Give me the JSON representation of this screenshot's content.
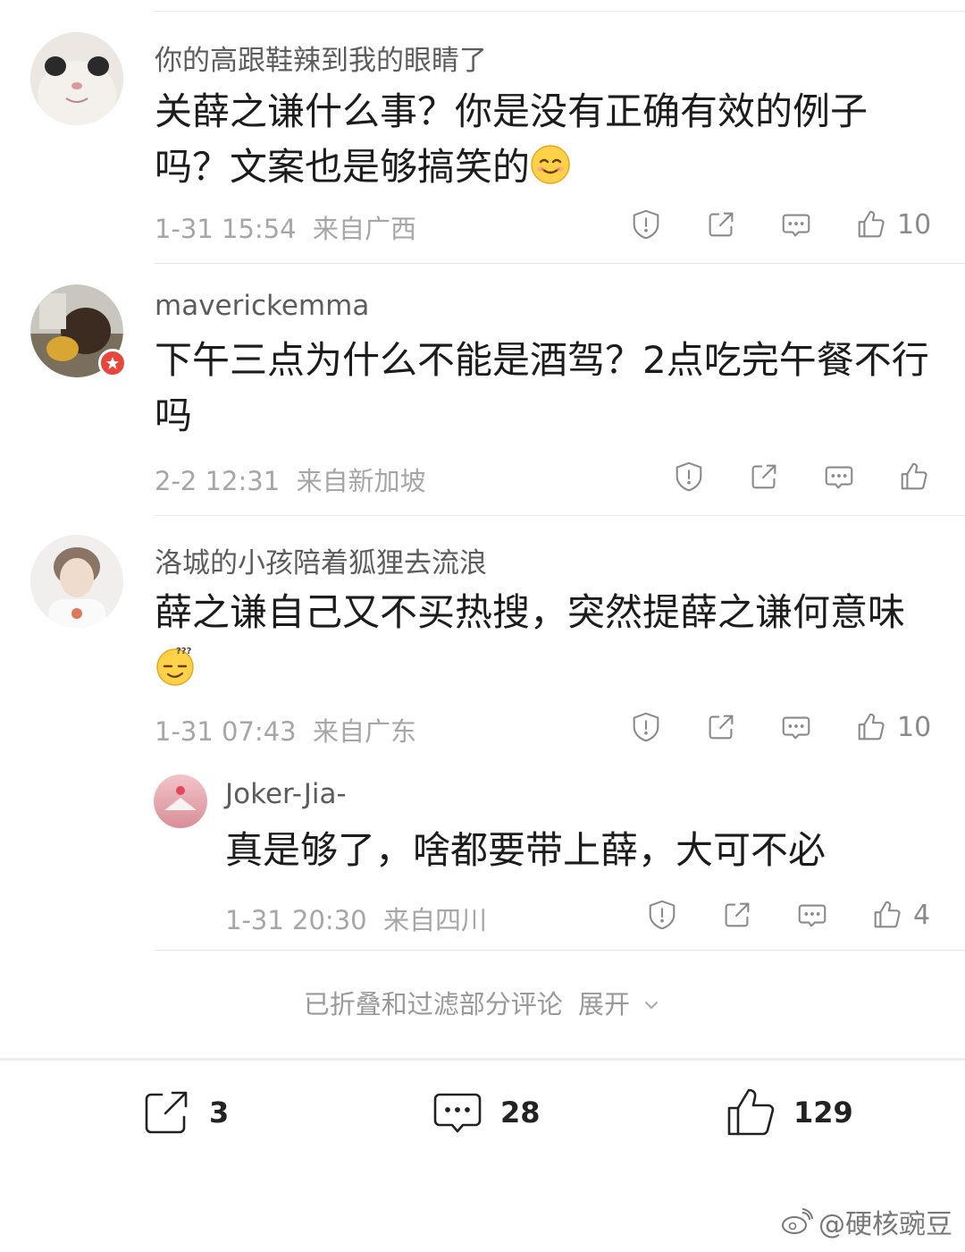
{
  "comments": [
    {
      "username": "你的高跟鞋辣到我的眼睛了",
      "text": "关薛之谦什么事？你是没有正确有效的例子吗？文案也是够搞笑的",
      "emoji": "smile-emoji",
      "time": "1-31 15:54",
      "location": "来自广西",
      "likes": "10"
    },
    {
      "username": "maverickemma",
      "text": "下午三点为什么不能是酒驾？2点吃完午餐不行吗",
      "time": "2-2 12:31",
      "location": "来自新加坡",
      "likes": ""
    },
    {
      "username": "洛城的小孩陪着狐狸去流浪",
      "text": "薛之谦自己又不买热搜，突然提薛之谦何意味",
      "emoji": "puzzled-emoji",
      "time": "1-31 07:43",
      "location": "来自广东",
      "likes": "10"
    }
  ],
  "reply": {
    "username": "Joker-Jia-",
    "text": "真是够了，啥都要带上薛，大可不必",
    "time": "1-31 20:30",
    "location": "来自四川",
    "likes": "4"
  },
  "collapsed": {
    "text": "已折叠和过滤部分评论",
    "expand_label": "展开"
  },
  "bottom_bar": {
    "share_count": "3",
    "comment_count": "28",
    "like_count": "129"
  },
  "watermark": "@硬核豌豆",
  "icons": [
    "report-icon",
    "share-icon",
    "comment-icon",
    "like-icon",
    "chevron-down-icon",
    "weibo-logo-icon"
  ]
}
